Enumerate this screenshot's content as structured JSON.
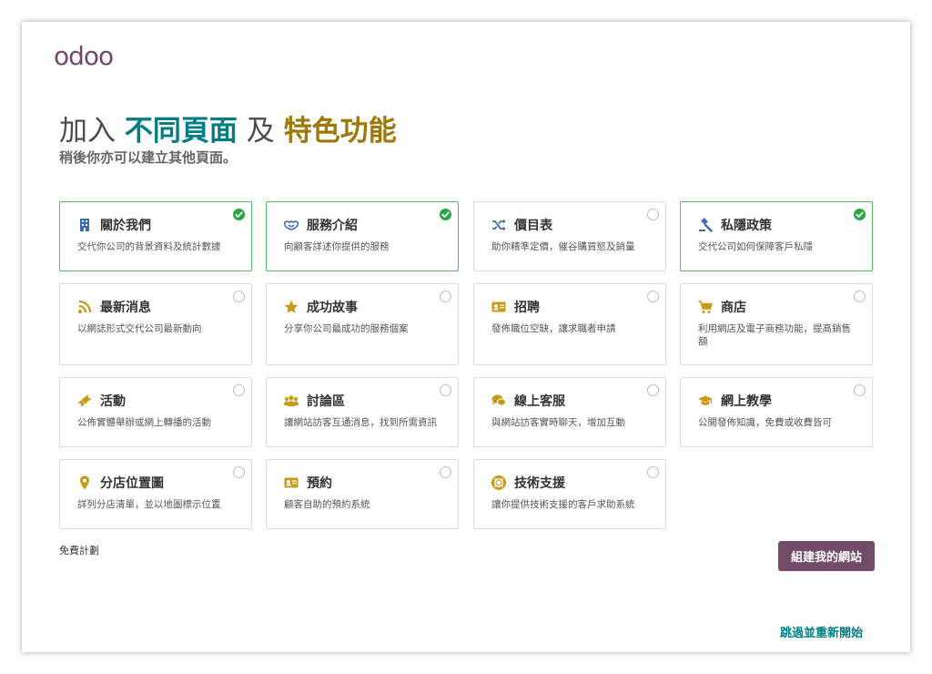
{
  "brand": {
    "logo": "odoo"
  },
  "header": {
    "title_part1": "加入",
    "title_highlight1": "不同頁面",
    "title_part2": "及",
    "title_highlight2": "特色功能",
    "subtitle": "稍後你亦可以建立其他頁面。"
  },
  "features": [
    {
      "title": "關於我們",
      "description": "交代你公司的背景資料及統計數據",
      "selected": true,
      "icon": "building-icon"
    },
    {
      "title": "服務介紹",
      "description": "向顧客詳述你提供的服務",
      "selected": true,
      "icon": "handshake-icon"
    },
    {
      "title": "價目表",
      "description": "助你精準定價，催谷購買慾及銷量",
      "selected": false,
      "icon": "shuffle-icon"
    },
    {
      "title": "私隱政策",
      "description": "交代公司如何保障客戶私隱",
      "selected": true,
      "icon": "gavel-icon"
    },
    {
      "title": "最新消息",
      "description": "以網誌形式交代公司最新動向",
      "selected": false,
      "icon": "rss-icon"
    },
    {
      "title": "成功故事",
      "description": "分享你公司最成功的服務個案",
      "selected": false,
      "icon": "star-icon"
    },
    {
      "title": "招聘",
      "description": "發佈職位空缺，讓求職者申請",
      "selected": false,
      "icon": "id-card-icon"
    },
    {
      "title": "商店",
      "description": "利用網店及電子商務功能，提高銷售額",
      "selected": false,
      "icon": "cart-icon"
    },
    {
      "title": "活動",
      "description": "公佈實體舉辦或網上轉播的活動",
      "selected": false,
      "icon": "ticket-icon"
    },
    {
      "title": "討論區",
      "description": "讓網站訪客互通消息，找到所需資訊",
      "selected": false,
      "icon": "users-icon"
    },
    {
      "title": "線上客服",
      "description": "與網站訪客實時聊天，增加互動",
      "selected": false,
      "icon": "comments-icon"
    },
    {
      "title": "網上教學",
      "description": "公開發佈知識，免費或收費皆可",
      "selected": false,
      "icon": "graduation-cap-icon"
    },
    {
      "title": "分店位置圖",
      "description": "詳列分店清單，並以地圖標示位置",
      "selected": false,
      "icon": "map-marker-icon"
    },
    {
      "title": "預約",
      "description": "顧客自助的預約系統",
      "selected": false,
      "icon": "address-card-icon"
    },
    {
      "title": "技術支援",
      "description": "讓你提供技術支援的客戶求助系統",
      "selected": false,
      "icon": "life-ring-icon"
    }
  ],
  "footer": {
    "free_plan_label": "免費計劃",
    "build_button": "組建我的網站",
    "skip_link": "跳過並重新開始"
  },
  "colors": {
    "brand_purple": "#714b67",
    "teal": "#017e84",
    "gold": "#9e7909",
    "selected_border": "#5cb85c",
    "check_green": "#28a745",
    "icon_blue": "#3b6bb5",
    "icon_gold": "#c79a16"
  }
}
